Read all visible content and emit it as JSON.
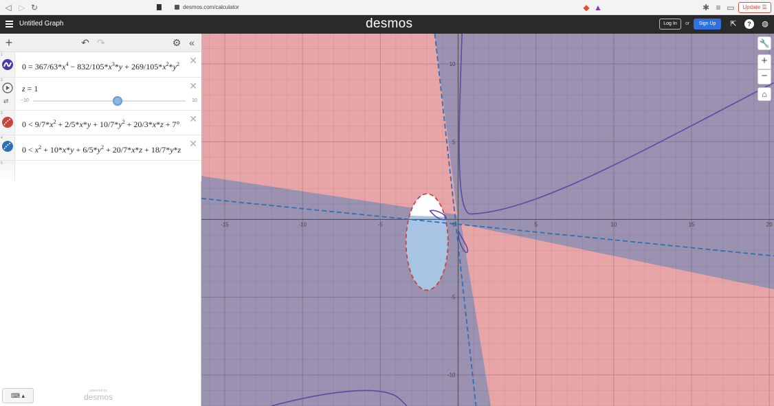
{
  "browser": {
    "url": "desmos.com/calculator",
    "update_label": "Update"
  },
  "header": {
    "title": "Untitled Graph",
    "logo": "desmos",
    "login_label": "Log In",
    "or_label": "or",
    "signup_label": "Sign Up"
  },
  "expressions": [
    {
      "num": "1",
      "latex_html": "0 = 367/63*<i>x</i><sup>4</sup> − 832/105*<i>x</i><sup>3</sup>*<i>y</i> + 269/105*<i>x</i><sup>2</sup>*<i>y</i><sup>2</sup>",
      "color": "#4b3aa7"
    },
    {
      "num": "2",
      "latex_html": "<i>z</i> = 1",
      "slider_min": "−10",
      "slider_max": "10"
    },
    {
      "num": "3",
      "latex_html": "0 &lt; 9/7*<i>x</i><sup>2</sup> + 2/5*<i>x</i>*<i>y</i> + 10/7*<i>y</i><sup>2</sup> + 20/3*<i>x</i>*<i>z</i> + 7°",
      "color": "#c74440"
    },
    {
      "num": "4",
      "latex_html": "0 &lt; <i>x</i><sup>2</sup> + 10*<i>x</i>*<i>y</i> + 6/5*<i>y</i><sup>2</sup> + 20/7*<i>x</i>*<i>z</i> + 18/7*<i>y</i>*<i>z</i>",
      "color": "#2d70b3"
    },
    {
      "num": "5"
    }
  ],
  "powered_by": {
    "line1": "powered by",
    "line2": "desmos"
  },
  "graph": {
    "x_ticks": [
      "-15",
      "-10",
      "-5",
      "0",
      "5",
      "10",
      "15",
      "20"
    ],
    "y_ticks": [
      "10",
      "5",
      "-5",
      "-10"
    ],
    "xlim": [
      -16.5,
      20.3
    ],
    "ylim": [
      -12,
      11.95
    ],
    "colors": {
      "red_region": "#e8a5a8",
      "purple_region": "#9a92b0",
      "blue_region": "#a7c4e2",
      "curve": "#5a4aa8",
      "red_dash": "#c74440",
      "blue_dash": "#2d70b3"
    }
  },
  "graph_tools": {
    "wrench": "wrench-icon",
    "zoom_in": "+",
    "zoom_out": "−",
    "home": "home-icon"
  }
}
